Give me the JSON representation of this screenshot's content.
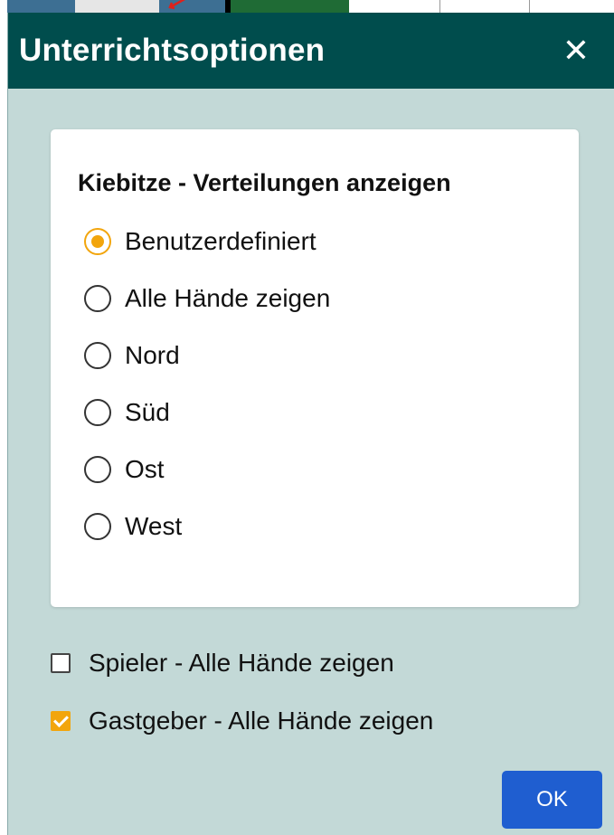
{
  "dialog": {
    "title": "Unterrichtsoptionen",
    "close_glyph": "✕"
  },
  "kiebitze": {
    "heading": "Kiebitze - Verteilungen anzeigen",
    "selected": "Benutzerdefiniert",
    "options": [
      {
        "label": "Benutzerdefiniert",
        "checked": true
      },
      {
        "label": "Alle Hände zeigen",
        "checked": false
      },
      {
        "label": "Nord",
        "checked": false
      },
      {
        "label": "Süd",
        "checked": false
      },
      {
        "label": "Ost",
        "checked": false
      },
      {
        "label": "West",
        "checked": false
      }
    ]
  },
  "checkboxes": [
    {
      "label": "Spieler - Alle Hände zeigen",
      "checked": false
    },
    {
      "label": "Gastgeber - Alle Hände zeigen",
      "checked": true
    }
  ],
  "footer": {
    "ok_label": "OK"
  },
  "colors": {
    "title_bar": "#004d4d",
    "background": "#c3d9d7",
    "accent": "#f2a50c",
    "ok_button": "#1f5ed0"
  }
}
